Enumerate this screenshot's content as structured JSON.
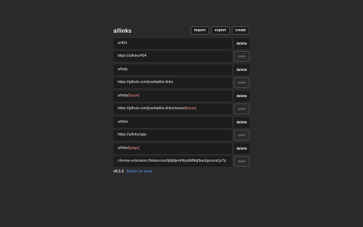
{
  "header": {
    "title": "a/links",
    "buttons": {
      "import": "import",
      "export": "export",
      "create": "create"
    }
  },
  "entries": [
    {
      "key_prefix": "a/404",
      "key_param": "",
      "url_prefix": "https://a/links/404",
      "url_param": "",
      "delete_label": "delete",
      "save_label": "save"
    },
    {
      "key_prefix": "a/help",
      "key_param": "",
      "url_prefix": "https://github.com/josefaidt/a-links",
      "url_param": "",
      "delete_label": "delete",
      "save_label": "save"
    },
    {
      "key_prefix": "a/help/",
      "key_param": "[issue]",
      "url_prefix": "https://github.com/josefaidt/a-links/issues/",
      "url_param": "[issue]",
      "delete_label": "delete",
      "save_label": "save"
    },
    {
      "key_prefix": "a/links",
      "key_param": "",
      "url_prefix": "https://a/links/app",
      "url_param": "",
      "delete_label": "delete",
      "save_label": "save"
    },
    {
      "key_prefix": "a/links/",
      "key_param": "[page]",
      "url_prefix": "chrome-extension://fekeocencfijbjkljemhlkpdkffiidj/background.js?p",
      "url_param": "",
      "delete_label": "delete",
      "save_label": "save"
    }
  ],
  "footer": {
    "version": "v0.1.3",
    "report_link": "Report an issue"
  },
  "colors": {
    "background": "#2a2a2b",
    "field": "#1c1c1d",
    "param_highlight": "#f28b82",
    "link": "#5b9cf5"
  }
}
